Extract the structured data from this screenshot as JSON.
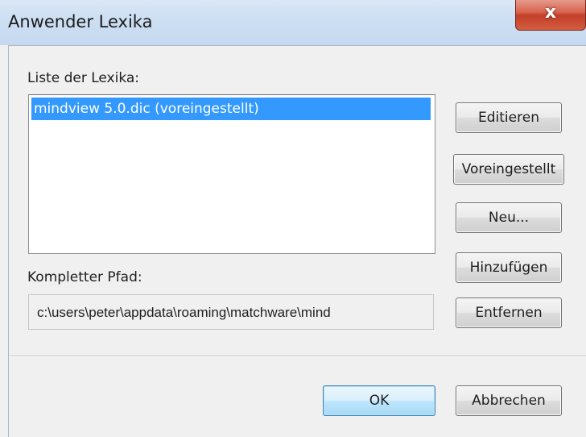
{
  "window": {
    "title": "Anwender Lexika",
    "close_label": "x"
  },
  "dictionary_list": {
    "label": "Liste der Lexika:",
    "items": [
      "mindview 5.0.dic (voreingestellt)"
    ],
    "selected_index": 0
  },
  "path": {
    "label": "Kompletter Pfad:",
    "value": "c:\\users\\peter\\appdata\\roaming\\matchware\\mind"
  },
  "side_buttons": {
    "edit": "Editieren",
    "set_default": "Voreingestellt",
    "new": "Neu...",
    "add": "Hinzufügen",
    "remove": "Entfernen"
  },
  "footer_buttons": {
    "ok": "OK",
    "cancel": "Abbrechen"
  },
  "colors": {
    "selection": "#3399ff",
    "close_button": "#d9644f",
    "title_bar": "#cfe0f3"
  }
}
